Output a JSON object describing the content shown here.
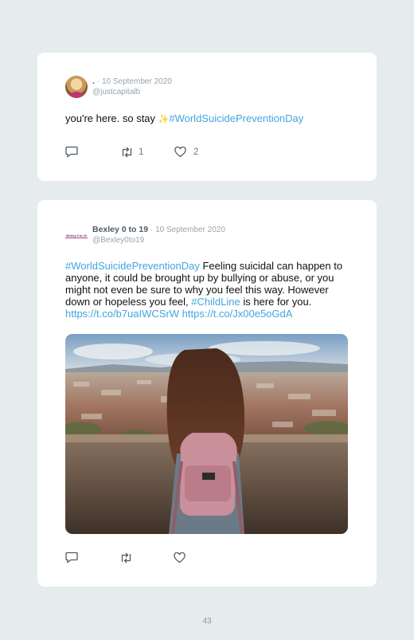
{
  "tweets": [
    {
      "name": ".",
      "date": "· 10 September 2020",
      "handle": "@justcapitalb",
      "text_before": "you're here. so stay ",
      "emoji": "✨",
      "hashtag": "#WorldSuicidePreventionDay",
      "reply_icon": "reply-icon",
      "retweet_icon": "retweet-icon",
      "like_icon": "heart-icon",
      "retweet_count": "1",
      "like_count": "2"
    },
    {
      "name": "Bexley 0 to 19",
      "date": "· 10 September 2020",
      "handle": "@Bexley0to19",
      "logo_text": "Bexley 0 to 19",
      "hashtag": "#WorldSuicidePreventionDay",
      "text_middle": " Feeling suicidal can happen to anyone, it could be brought up by bullying or abuse, or you might not even be sure to why you feel this way. However down or hopeless you feel, ",
      "hashtag2": "#ChildLine",
      "text_after": " is here for you. ",
      "link1": "https://t.co/b7uaIWCSrW",
      "link2": "https://t.co/Jx00e5oGdA",
      "reply_icon": "reply-icon",
      "retweet_icon": "retweet-icon",
      "like_icon": "heart-icon",
      "retweet_count": "",
      "like_count": ""
    }
  ],
  "page_number": "43"
}
